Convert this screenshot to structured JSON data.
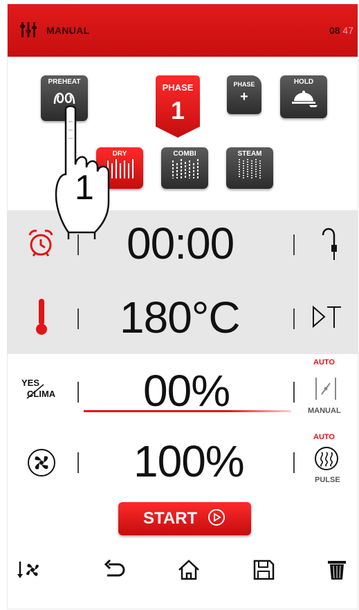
{
  "header": {
    "mode": "MANUAL",
    "clock_hours": "08",
    "clock_minutes": "47"
  },
  "phases": {
    "preheat_label": "PREHEAT",
    "phase_label": "PHASE",
    "phase_number": "1",
    "add_phase_label": "PHASE",
    "add_phase_symbol": "+",
    "hold_label": "HOLD"
  },
  "modes": {
    "dry": "DRY",
    "combi": "COMBI",
    "steam": "STEAM",
    "active": "dry"
  },
  "time": {
    "value": "00:00"
  },
  "temperature": {
    "value": "180°C"
  },
  "climate": {
    "logo_top": "YES",
    "logo_bottom": "CLIMA",
    "value": "00%",
    "auto_label": "AUTO",
    "manual_label": "MANUAL",
    "level": 0.0
  },
  "fan": {
    "value": "100%",
    "auto_label": "AUTO",
    "pulse_label": "PULSE"
  },
  "start": {
    "label": "START"
  },
  "tutorial": {
    "step_number": "1"
  },
  "colors": {
    "accent": "#e41414",
    "tile_dark": "#3a3a3a",
    "band_gray": "#e7e7e7"
  }
}
